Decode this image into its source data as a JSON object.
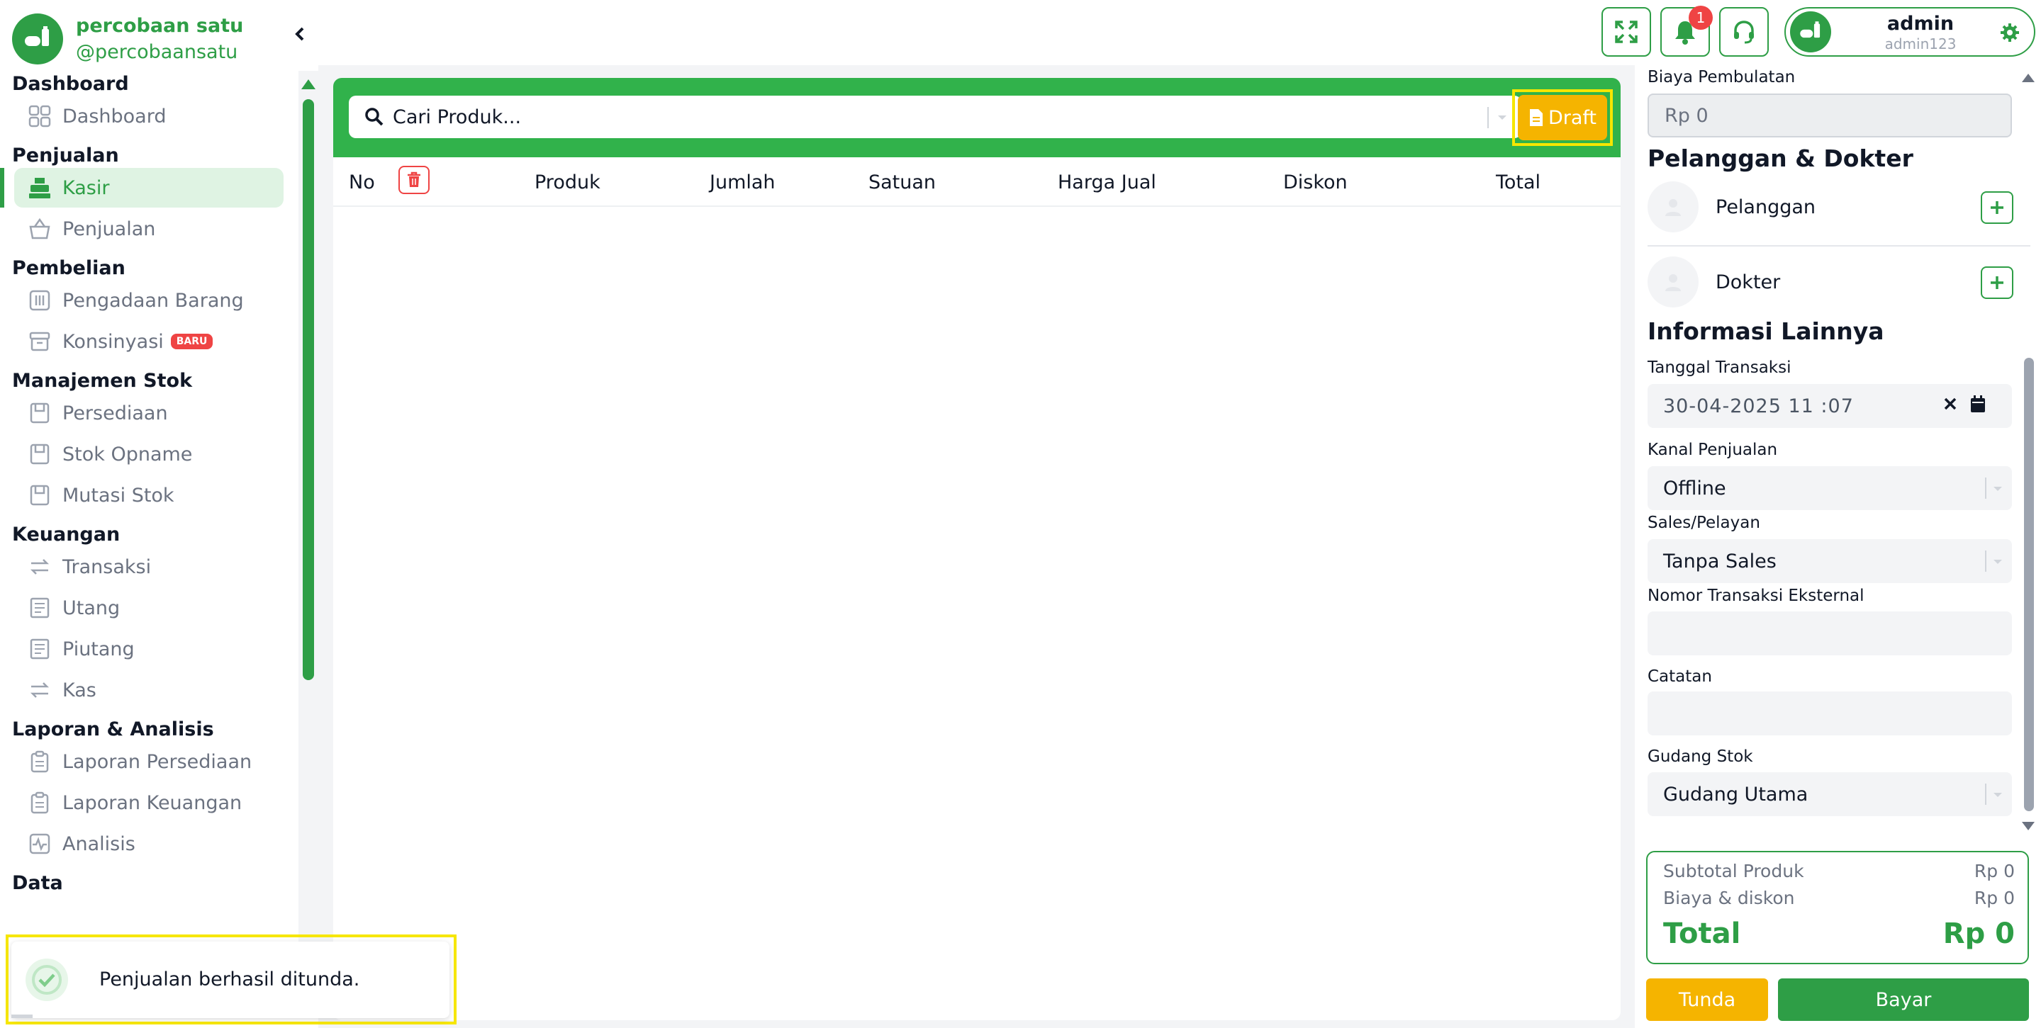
{
  "brand": {
    "name": "percobaan satu",
    "handle": "@percobaansatu"
  },
  "sidebar": {
    "sections": [
      {
        "title": "Dashboard",
        "items": [
          {
            "label": "Dashboard",
            "icon": "grid-icon"
          }
        ]
      },
      {
        "title": "Penjualan",
        "items": [
          {
            "label": "Kasir",
            "icon": "cash-register-icon",
            "active": true
          },
          {
            "label": "Penjualan",
            "icon": "basket-icon"
          }
        ]
      },
      {
        "title": "Pembelian",
        "items": [
          {
            "label": "Pengadaan Barang",
            "icon": "procurement-icon"
          },
          {
            "label": "Konsinyasi",
            "icon": "archive-box-icon",
            "badge": "BARU"
          }
        ]
      },
      {
        "title": "Manajemen Stok",
        "items": [
          {
            "label": "Persediaan",
            "icon": "inventory-icon"
          },
          {
            "label": "Stok Opname",
            "icon": "stock-opname-icon"
          },
          {
            "label": "Mutasi Stok",
            "icon": "stock-mutation-icon"
          }
        ]
      },
      {
        "title": "Keuangan",
        "items": [
          {
            "label": "Transaksi",
            "icon": "transfer-arrows-icon"
          },
          {
            "label": "Utang",
            "icon": "receipt-icon"
          },
          {
            "label": "Piutang",
            "icon": "receipt-icon"
          },
          {
            "label": "Kas",
            "icon": "transfer-arrows-icon"
          }
        ]
      },
      {
        "title": "Laporan & Analisis",
        "items": [
          {
            "label": "Laporan Persediaan",
            "icon": "clipboard-icon"
          },
          {
            "label": "Laporan Keuangan",
            "icon": "clipboard-icon"
          },
          {
            "label": "Analisis",
            "icon": "activity-chart-icon"
          }
        ]
      },
      {
        "title": "Data",
        "items": []
      }
    ]
  },
  "topbar": {
    "notification_count": "1",
    "user": {
      "name": "admin",
      "username": "admin123"
    }
  },
  "main": {
    "search_placeholder": "Cari Produk...",
    "draft_label": "Draft",
    "columns": {
      "no": "No",
      "produk": "Produk",
      "jumlah": "Jumlah",
      "satuan": "Satuan",
      "harga_jual": "Harga Jual",
      "diskon": "Diskon",
      "total": "Total"
    }
  },
  "right": {
    "biaya_pembulatan_label": "Biaya Pembulatan",
    "biaya_pembulatan_value": "Rp 0",
    "pelanggan_dokter_heading": "Pelanggan & Dokter",
    "pelanggan_label": "Pelanggan",
    "dokter_label": "Dokter",
    "info_heading": "Informasi Lainnya",
    "tanggal_label": "Tanggal Transaksi",
    "tanggal_value": "30-04-2025 11 :07",
    "kanal_label": "Kanal Penjualan",
    "kanal_value": "Offline",
    "sales_label": "Sales/Pelayan",
    "sales_value": "Tanpa Sales",
    "nomor_eksternal_label": "Nomor Transaksi Eksternal",
    "nomor_eksternal_value": "",
    "catatan_label": "Catatan",
    "catatan_value": "",
    "gudang_label": "Gudang Stok",
    "gudang_value": "Gudang Utama"
  },
  "summary": {
    "subtotal_label": "Subtotal Produk",
    "subtotal_value": "Rp 0",
    "biaya_label": "Biaya & diskon",
    "biaya_value": "Rp 0",
    "total_label": "Total",
    "total_value": "Rp 0"
  },
  "actions": {
    "tunda": "Tunda",
    "bayar": "Bayar"
  },
  "toast": {
    "message": "Penjualan berhasil ditunda."
  },
  "colors": {
    "primary": "#2e9e46",
    "header_green": "#31b24b",
    "warning": "#f5b400",
    "danger": "#ef4444"
  }
}
